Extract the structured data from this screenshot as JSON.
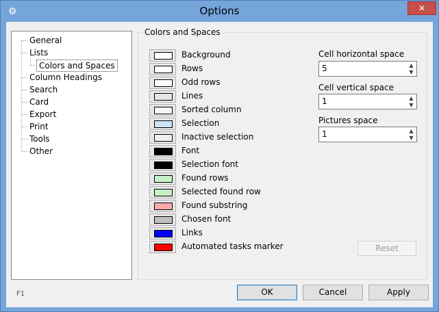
{
  "window": {
    "title": "Options",
    "close_glyph": "✕"
  },
  "tree": {
    "items": [
      {
        "label": "General"
      },
      {
        "label": "Lists"
      },
      {
        "label": "Colors and Spaces"
      },
      {
        "label": "Column Headings"
      },
      {
        "label": "Search"
      },
      {
        "label": "Card"
      },
      {
        "label": "Export"
      },
      {
        "label": "Print"
      },
      {
        "label": "Tools"
      },
      {
        "label": "Other"
      }
    ],
    "selected": "Colors and Spaces"
  },
  "panel": {
    "title": "Colors and Spaces",
    "colors": [
      {
        "label": "Background",
        "color": "#ffffff"
      },
      {
        "label": "Rows",
        "color": "#ffffff"
      },
      {
        "label": "Odd rows",
        "color": "#ffffff"
      },
      {
        "label": "Lines",
        "color": "#e6e6e6"
      },
      {
        "label": "Sorted column",
        "color": "#f6f6f6"
      },
      {
        "label": "Selection",
        "color": "#cce4f7"
      },
      {
        "label": "Inactive selection",
        "color": "#f0f0f0"
      },
      {
        "label": "Font",
        "color": "#000000"
      },
      {
        "label": "Selection font",
        "color": "#000000"
      },
      {
        "label": "Found rows",
        "color": "#c8f0c8"
      },
      {
        "label": "Selected found row",
        "color": "#c8f0c8"
      },
      {
        "label": "Found substring",
        "color": "#ffaaaa"
      },
      {
        "label": "Chosen font",
        "color": "#c0c0c0"
      },
      {
        "label": "Links",
        "color": "#0000ff"
      },
      {
        "label": "Automated tasks marker",
        "color": "#ff0000"
      }
    ],
    "spaces": {
      "cell_horizontal": {
        "label": "Cell horizontal space",
        "value": "5"
      },
      "cell_vertical": {
        "label": "Cell vertical space",
        "value": "1"
      },
      "pictures": {
        "label": "Pictures space",
        "value": "1"
      }
    },
    "reset_label": "Reset"
  },
  "footer": {
    "help_hint": "F1",
    "ok_label": "OK",
    "cancel_label": "Cancel",
    "apply_label": "Apply"
  }
}
